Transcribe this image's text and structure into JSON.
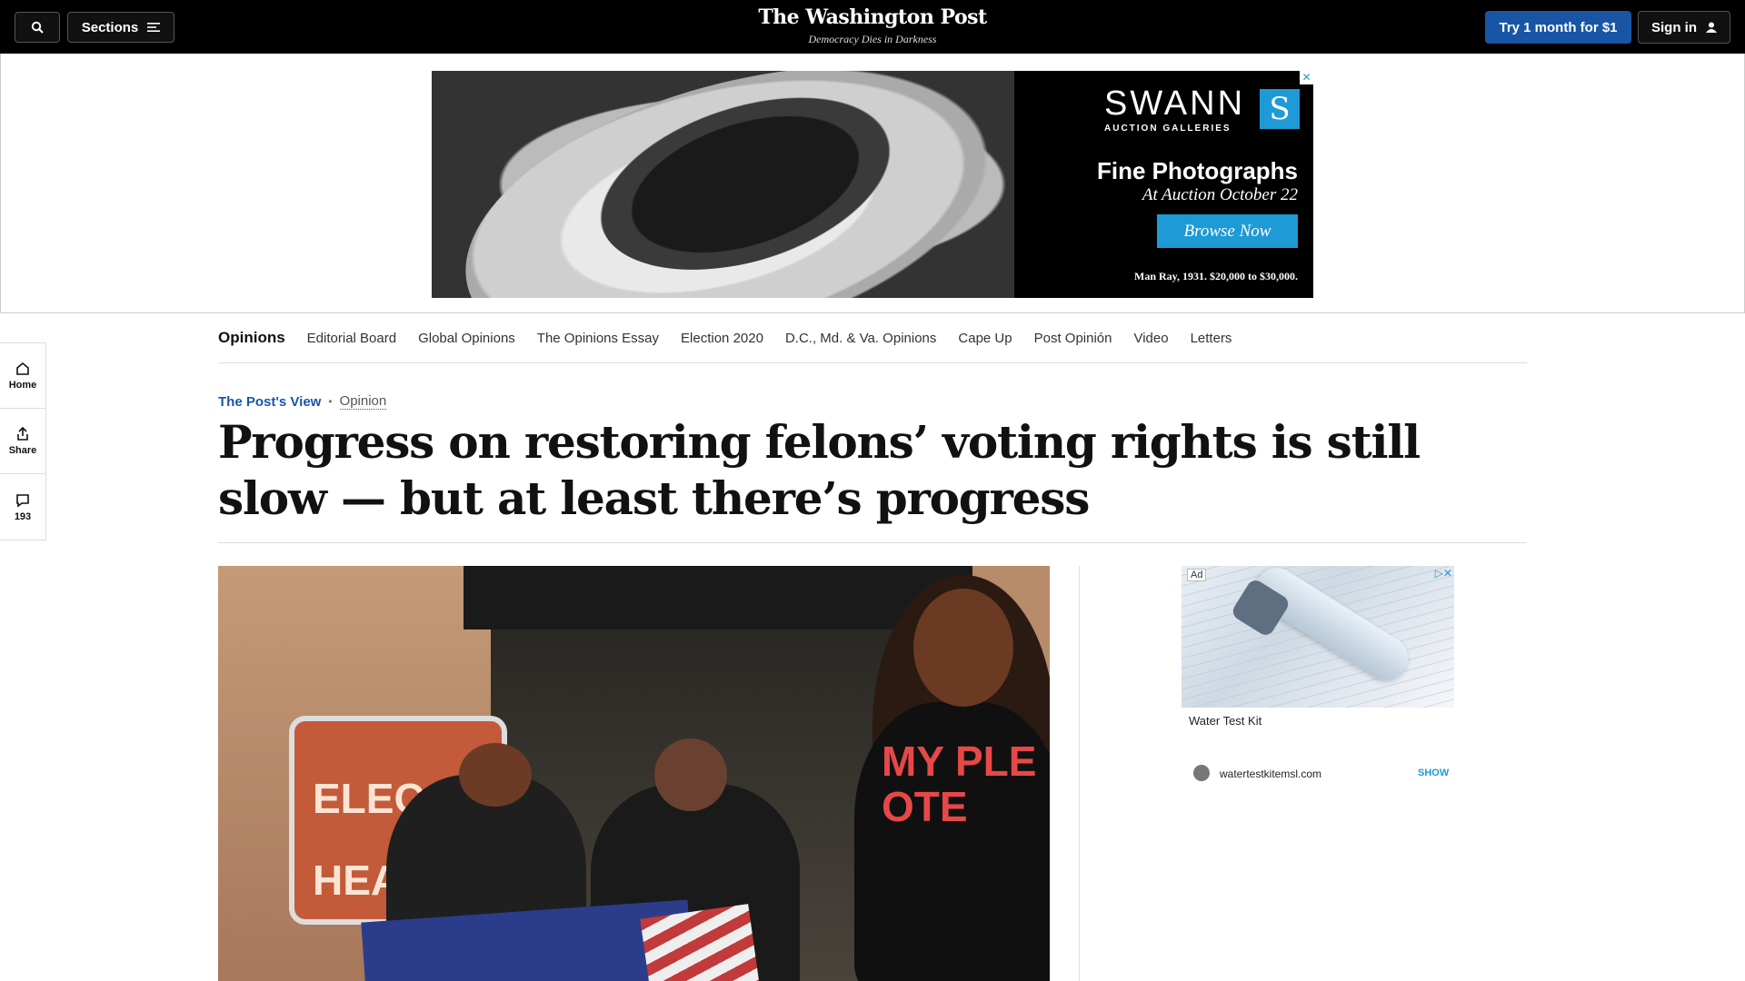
{
  "header": {
    "sections_label": "Sections",
    "logo": "The Washington Post",
    "tagline": "Democracy Dies in Darkness",
    "try_label": "Try 1 month for $1",
    "signin_label": "Sign in",
    "icons": [
      "search-icon",
      "menu-icon",
      "user-icon"
    ]
  },
  "banner_ad": {
    "brand": "SWANN",
    "brand_sub": "AUCTION GALLERIES",
    "brand_mark": "S",
    "headline": "Fine Photographs",
    "date": "At Auction October 22",
    "cta": "Browse Now",
    "caption": "Man Ray, 1931. $20,000 to $30,000.",
    "close": "✕"
  },
  "rail": {
    "home": "Home",
    "share": "Share",
    "comments": "193"
  },
  "subnav": {
    "items": [
      "Opinions",
      "Editorial Board",
      "Global Opinions",
      "The Opinions Essay",
      "Election 2020",
      "D.C., Md. & Va. Opinions",
      "Cape Up",
      "Post Opinión",
      "Video",
      "Letters"
    ]
  },
  "article": {
    "kicker": "The Post's View",
    "kicker_sep": "•",
    "section": "Opinion",
    "headline": "Progress on restoring felons’ voting rights is still slow — but at least there’s progress"
  },
  "photo": {
    "sign_text": "ELEC HEADQ",
    "shirt_text": "MY PLE OTE"
  },
  "side_ad": {
    "badge": "Ad",
    "title": "Water Test Kit",
    "url": "watertestkitemsl.com",
    "show": "SHOW",
    "close": "▷✕"
  }
}
